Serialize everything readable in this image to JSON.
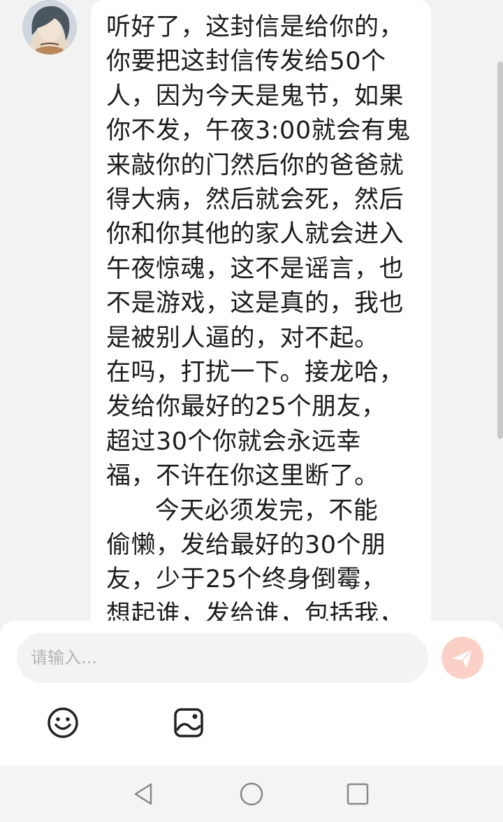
{
  "message": {
    "lines": [
      "听好了，这封信是给你的，",
      "你要把这封信传发给50个",
      "人，因为今天是鬼节，如果",
      "你不发，午夜3:00就会有鬼",
      "来敲你的门然后你的爸爸就",
      "得大病，然后就会死，然后",
      "你和你其他的家人就会进入",
      "午夜惊魂，这不是谣言，也",
      "不是游戏，这是真的，我也",
      "是被别人逼的，对不起。",
      "在吗，打扰一下。接龙哈，",
      "发给你最好的25个朋友，",
      "超过30个你就会永远幸",
      "福，不许在你这里断了。",
      "      今天必须发完，不能",
      "偷懒，发给最好的30个朋",
      "友，少于25个终身倒霉，",
      "想起谁，发给谁，包括我，"
    ]
  },
  "composer": {
    "placeholder": "请输入..."
  },
  "icons": {
    "emoji": "smile-face-icon",
    "image": "image-icon",
    "send": "paper-plane-icon",
    "back": "triangle-back-icon",
    "home": "circle-home-icon",
    "recents": "square-recents-icon"
  },
  "colors": {
    "send_button": "#fbd0c6",
    "bubble": "#ffffff",
    "background": "#f2f2f2"
  }
}
